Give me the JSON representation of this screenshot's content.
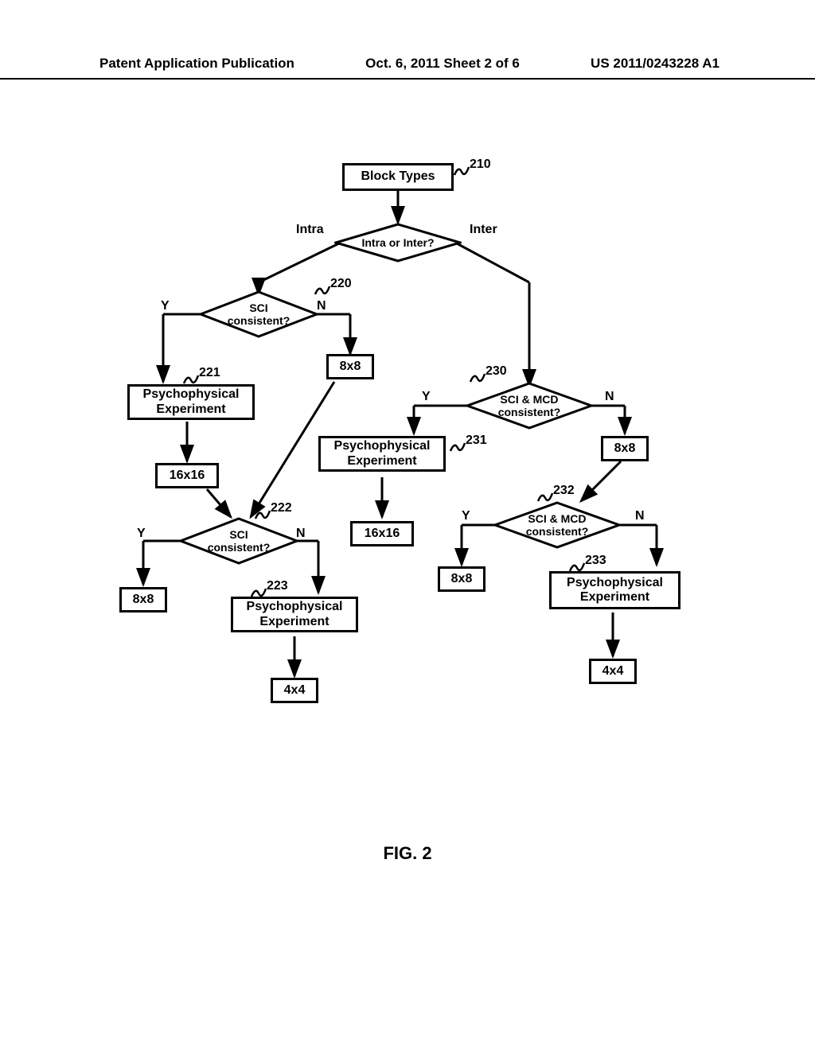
{
  "header": {
    "left": "Patent Application Publication",
    "middle": "Oct. 6, 2011  Sheet 2 of 6",
    "right": "US 2011/0243228 A1"
  },
  "refs": {
    "r210": "210",
    "r220": "220",
    "r221": "221",
    "r222": "222",
    "r223": "223",
    "r230": "230",
    "r231": "231",
    "r232": "232",
    "r233": "233"
  },
  "nodes": {
    "block_types": "Block Types",
    "intra_inter": "Intra or Inter?",
    "sci_a": "SCI\nconsistent?",
    "sci_b": "SCI\nconsistent?",
    "sci_mcd_a": "SCI & MCD\nconsistent?",
    "sci_mcd_b": "SCI & MCD\nconsistent?",
    "psy": "Psychophysical\nExperiment",
    "s16": "16x16",
    "s8": "8x8",
    "s4": "4x4"
  },
  "edge_labels": {
    "intra": "Intra",
    "inter": "Inter",
    "y": "Y",
    "n": "N"
  },
  "caption": "FIG. 2"
}
